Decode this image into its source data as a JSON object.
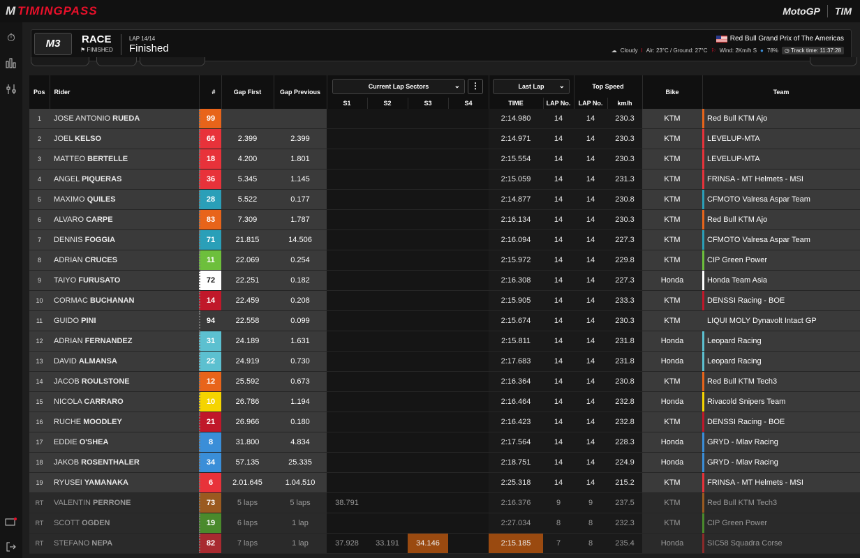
{
  "app": {
    "brand_left": "M",
    "brand_title": "TIMINGPASS",
    "brand_motogp": "MotoGP",
    "brand_tim": "TIM"
  },
  "header": {
    "class_logo": "M3",
    "race_label": "RACE",
    "race_state": "FINISHED",
    "lap_label": "LAP 14/14",
    "lap_status": "Finished",
    "event_name": "Red Bull Grand Prix of The Americas",
    "weather": "Cloudy",
    "air_ground": "Air: 23°C / Ground: 27°C",
    "wind": "Wind: 2Km/h S",
    "humidity": "78%",
    "track_time": "Track time: 11:37:28"
  },
  "columns": {
    "pos": "Pos",
    "rider": "Rider",
    "num": "#",
    "gap_first": "Gap First",
    "gap_previous": "Gap Previous",
    "current_lap_sectors": "Current Lap Sectors",
    "last_lap": "Last Lap",
    "top_speed": "Top Speed",
    "bike": "Bike",
    "team": "Team",
    "s1": "S1",
    "s2": "S2",
    "s3": "S3",
    "s4": "S4",
    "time": "TIME",
    "lap_no": "LAP No.",
    "lap_no2": "LAP No.",
    "kmh": "km/h"
  },
  "rows": [
    {
      "pos": "1",
      "first": "JOSE ANTONIO",
      "last": "RUEDA",
      "num": "99",
      "plate": "#e8641a",
      "gap1": "",
      "gap2": "",
      "s1": "",
      "s2": "",
      "s3": "",
      "s4": "",
      "time": "2:14.980",
      "lap": "14",
      "lap2": "14",
      "speed": "230.3",
      "bike": "KTM",
      "team": "Red Bull KTM Ajo",
      "teamc": "#e8641a",
      "mark": ""
    },
    {
      "pos": "2",
      "first": "JOEL",
      "last": "KELSO",
      "num": "66",
      "plate": "#e8323a",
      "gap1": "2.399",
      "gap2": "2.399",
      "s1": "",
      "s2": "",
      "s3": "",
      "s4": "",
      "time": "2:14.971",
      "lap": "14",
      "lap2": "14",
      "speed": "230.3",
      "bike": "KTM",
      "team": "LEVELUP-MTA",
      "teamc": "#e8323a",
      "mark": ""
    },
    {
      "pos": "3",
      "first": "MATTEO",
      "last": "BERTELLE",
      "num": "18",
      "plate": "#e8323a",
      "gap1": "4.200",
      "gap2": "1.801",
      "s1": "",
      "s2": "",
      "s3": "",
      "s4": "",
      "time": "2:15.554",
      "lap": "14",
      "lap2": "14",
      "speed": "230.3",
      "bike": "KTM",
      "team": "LEVELUP-MTA",
      "teamc": "#e8323a",
      "mark": ""
    },
    {
      "pos": "4",
      "first": "ANGEL",
      "last": "PIQUERAS",
      "num": "36",
      "plate": "#e8323a",
      "gap1": "5.345",
      "gap2": "1.145",
      "s1": "",
      "s2": "",
      "s3": "",
      "s4": "",
      "time": "2:15.059",
      "lap": "14",
      "lap2": "14",
      "speed": "231.3",
      "bike": "KTM",
      "team": "FRINSA - MT Helmets - MSI",
      "teamc": "#e8323a",
      "mark": ""
    },
    {
      "pos": "5",
      "first": "MAXIMO",
      "last": "QUILES",
      "num": "28",
      "plate": "#2a9fb8",
      "gap1": "5.522",
      "gap2": "0.177",
      "s1": "",
      "s2": "",
      "s3": "",
      "s4": "",
      "time": "2:14.877",
      "lap": "14",
      "lap2": "14",
      "speed": "230.8",
      "bike": "KTM",
      "team": "CFMOTO Valresa Aspar Team",
      "teamc": "#2a9fb8",
      "mark": ""
    },
    {
      "pos": "6",
      "first": "ALVARO",
      "last": "CARPE",
      "num": "83",
      "plate": "#e8641a",
      "gap1": "7.309",
      "gap2": "1.787",
      "s1": "",
      "s2": "",
      "s3": "",
      "s4": "",
      "time": "2:16.134",
      "lap": "14",
      "lap2": "14",
      "speed": "230.3",
      "bike": "KTM",
      "team": "Red Bull KTM Ajo",
      "teamc": "#e8641a",
      "mark": ""
    },
    {
      "pos": "7",
      "first": "DENNIS",
      "last": "FOGGIA",
      "num": "71",
      "plate": "#2a9fb8",
      "gap1": "21.815",
      "gap2": "14.506",
      "s1": "",
      "s2": "",
      "s3": "",
      "s4": "",
      "time": "2:16.094",
      "lap": "14",
      "lap2": "14",
      "speed": "227.3",
      "bike": "KTM",
      "team": "CFMOTO Valresa Aspar Team",
      "teamc": "#2a9fb8",
      "mark": ""
    },
    {
      "pos": "8",
      "first": "ADRIAN",
      "last": "CRUCES",
      "num": "11",
      "plate": "#6dbf3c",
      "gap1": "22.069",
      "gap2": "0.254",
      "s1": "",
      "s2": "",
      "s3": "",
      "s4": "",
      "time": "2:15.972",
      "lap": "14",
      "lap2": "14",
      "speed": "229.8",
      "bike": "KTM",
      "team": "CIP Green Power",
      "teamc": "#6dbf3c",
      "mark": ""
    },
    {
      "pos": "9",
      "first": "TAIYO",
      "last": "FURUSATO",
      "num": "72",
      "plate": "#ffffff",
      "gap1": "22.251",
      "gap2": "0.182",
      "s1": "",
      "s2": "",
      "s3": "",
      "s4": "",
      "time": "2:16.308",
      "lap": "14",
      "lap2": "14",
      "speed": "227.3",
      "bike": "Honda",
      "team": "Honda Team Asia",
      "teamc": "#ffffff",
      "mark": ""
    },
    {
      "pos": "10",
      "first": "CORMAC",
      "last": "BUCHANAN",
      "num": "14",
      "plate": "#c0182a",
      "gap1": "22.459",
      "gap2": "0.208",
      "s1": "",
      "s2": "",
      "s3": "",
      "s4": "",
      "time": "2:15.905",
      "lap": "14",
      "lap2": "14",
      "speed": "233.3",
      "bike": "KTM",
      "team": "DENSSI Racing - BOE",
      "teamc": "#c0182a",
      "mark": ""
    },
    {
      "pos": "11",
      "first": "GUIDO",
      "last": "PINI",
      "num": "94",
      "plate": "#3a3a3a",
      "gap1": "22.558",
      "gap2": "0.099",
      "s1": "",
      "s2": "",
      "s3": "",
      "s4": "",
      "time": "2:15.674",
      "lap": "14",
      "lap2": "14",
      "speed": "230.3",
      "bike": "KTM",
      "team": "LIQUI MOLY Dynavolt Intact GP",
      "teamc": "#3a3a3a",
      "mark": ""
    },
    {
      "pos": "12",
      "first": "ADRIAN",
      "last": "FERNANDEZ",
      "num": "31",
      "plate": "#5cc0d0",
      "gap1": "24.189",
      "gap2": "1.631",
      "s1": "",
      "s2": "",
      "s3": "",
      "s4": "",
      "time": "2:15.811",
      "lap": "14",
      "lap2": "14",
      "speed": "231.8",
      "bike": "Honda",
      "team": "Leopard Racing",
      "teamc": "#5cc0d0",
      "mark": ""
    },
    {
      "pos": "13",
      "first": "DAVID",
      "last": "ALMANSA",
      "num": "22",
      "plate": "#5cc0d0",
      "gap1": "24.919",
      "gap2": "0.730",
      "s1": "",
      "s2": "",
      "s3": "",
      "s4": "",
      "time": "2:17.683",
      "lap": "14",
      "lap2": "14",
      "speed": "231.8",
      "bike": "Honda",
      "team": "Leopard Racing",
      "teamc": "#5cc0d0",
      "mark": ""
    },
    {
      "pos": "14",
      "first": "JACOB",
      "last": "ROULSTONE",
      "num": "12",
      "plate": "#e8641a",
      "gap1": "25.592",
      "gap2": "0.673",
      "s1": "",
      "s2": "",
      "s3": "",
      "s4": "",
      "time": "2:16.364",
      "lap": "14",
      "lap2": "14",
      "speed": "230.8",
      "bike": "KTM",
      "team": "Red Bull KTM Tech3",
      "teamc": "#e8641a",
      "mark": ""
    },
    {
      "pos": "15",
      "first": "NICOLA",
      "last": "CARRARO",
      "num": "10",
      "plate": "#f5d400",
      "gap1": "26.786",
      "gap2": "1.194",
      "s1": "",
      "s2": "",
      "s3": "",
      "s4": "",
      "time": "2:16.464",
      "lap": "14",
      "lap2": "14",
      "speed": "232.8",
      "bike": "Honda",
      "team": "Rivacold Snipers Team",
      "teamc": "#f5d400",
      "mark": ""
    },
    {
      "pos": "16",
      "first": "RUCHE",
      "last": "MOODLEY",
      "num": "21",
      "plate": "#c0182a",
      "gap1": "26.966",
      "gap2": "0.180",
      "s1": "",
      "s2": "",
      "s3": "",
      "s4": "",
      "time": "2:16.423",
      "lap": "14",
      "lap2": "14",
      "speed": "232.8",
      "bike": "KTM",
      "team": "DENSSI Racing - BOE",
      "teamc": "#c0182a",
      "mark": ""
    },
    {
      "pos": "17",
      "first": "EDDIE",
      "last": "O'SHEA",
      "num": "8",
      "plate": "#3a8ed8",
      "gap1": "31.800",
      "gap2": "4.834",
      "s1": "",
      "s2": "",
      "s3": "",
      "s4": "",
      "time": "2:17.564",
      "lap": "14",
      "lap2": "14",
      "speed": "228.3",
      "bike": "Honda",
      "team": "GRYD - Mlav Racing",
      "teamc": "#3a8ed8",
      "mark": ""
    },
    {
      "pos": "18",
      "first": "JAKOB",
      "last": "ROSENTHALER",
      "num": "34",
      "plate": "#3a8ed8",
      "gap1": "57.135",
      "gap2": "25.335",
      "s1": "",
      "s2": "",
      "s3": "",
      "s4": "",
      "time": "2:18.751",
      "lap": "14",
      "lap2": "14",
      "speed": "224.9",
      "bike": "Honda",
      "team": "GRYD - Mlav Racing",
      "teamc": "#3a8ed8",
      "mark": ""
    },
    {
      "pos": "19",
      "first": "RYUSEI",
      "last": "YAMANAKA",
      "num": "6",
      "plate": "#e8323a",
      "gap1": "2.01.645",
      "gap2": "1.04.510",
      "s1": "",
      "s2": "",
      "s3": "",
      "s4": "",
      "time": "2:25.318",
      "lap": "14",
      "lap2": "14",
      "speed": "215.2",
      "bike": "KTM",
      "team": "FRINSA - MT Helmets - MSI",
      "teamc": "#e8323a",
      "mark": ""
    },
    {
      "pos": "RT",
      "first": "VALENTIN",
      "last": "PERRONE",
      "num": "73",
      "plate": "#9a5a20",
      "gap1": "5 laps",
      "gap2": "5 laps",
      "s1": "38.791",
      "s2": "",
      "s3": "",
      "s4": "",
      "time": "2:16.376",
      "lap": "9",
      "lap2": "9",
      "speed": "237.5",
      "bike": "KTM",
      "team": "Red Bull KTM Tech3",
      "teamc": "#9a5a20",
      "mark": ""
    },
    {
      "pos": "RT",
      "first": "SCOTT",
      "last": "OGDEN",
      "num": "19",
      "plate": "#4a8a2c",
      "gap1": "6 laps",
      "gap2": "1 lap",
      "s1": "",
      "s2": "",
      "s3": "",
      "s4": "",
      "time": "2:27.034",
      "lap": "8",
      "lap2": "8",
      "speed": "232.3",
      "bike": "KTM",
      "team": "CIP Green Power",
      "teamc": "#4a8a2c",
      "mark": "P"
    },
    {
      "pos": "RT",
      "first": "STEFANO",
      "last": "NEPA",
      "num": "82",
      "plate": "#a82a30",
      "gap1": "7 laps",
      "gap2": "1 lap",
      "s1": "37.928",
      "s2": "33.191",
      "s3": "34.146",
      "s4": "",
      "time": "2:15.185",
      "lap": "7",
      "lap2": "8",
      "speed": "235.4",
      "bike": "Honda",
      "team": "SIC58 Squadra Corse",
      "teamc": "#8a2a2a",
      "mark": ""
    }
  ]
}
